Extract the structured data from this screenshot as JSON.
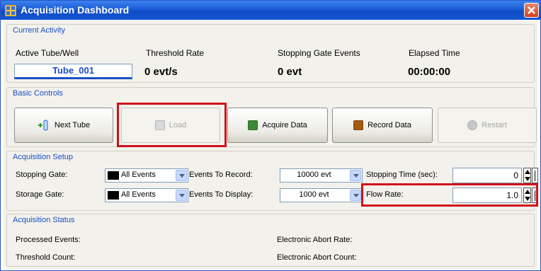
{
  "window": {
    "title": "Acquisition Dashboard"
  },
  "current_activity": {
    "group_title": "Current Activity",
    "labels": {
      "active_tube": "Active Tube/Well",
      "threshold_rate": "Threshold Rate",
      "stopping_gate_events": "Stopping Gate Events",
      "elapsed_time": "Elapsed Time"
    },
    "values": {
      "active_tube": "Tube_001",
      "threshold_rate": "0 evt/s",
      "stopping_gate_events": "0 evt",
      "elapsed_time": "00:00:00"
    }
  },
  "basic_controls": {
    "group_title": "Basic Controls",
    "buttons": {
      "next_tube": "Next Tube",
      "load": "Load",
      "acquire": "Acquire Data",
      "record": "Record Data",
      "restart": "Restart"
    }
  },
  "acquisition_setup": {
    "group_title": "Acquisition Setup",
    "labels": {
      "stopping_gate": "Stopping Gate:",
      "storage_gate": "Storage Gate:",
      "events_to_record": "Events To Record:",
      "events_to_display": "Events To Display:",
      "stopping_time": "Stopping Time (sec):",
      "flow_rate": "Flow Rate:"
    },
    "values": {
      "stopping_gate": "All Events",
      "storage_gate": "All Events",
      "events_to_record": "10000 evt",
      "events_to_display": "1000 evt",
      "stopping_time": "0",
      "flow_rate": "1.0"
    }
  },
  "acquisition_status": {
    "group_title": "Acquisition Status",
    "labels": {
      "processed_events": "Processed Events:",
      "threshold_count": "Threshold Count:",
      "electronic_abort_rate": "Electronic Abort Rate:",
      "electronic_abort_count": "Electronic Abort Count:"
    }
  },
  "colors": {
    "title_bar": "#1a5bd6",
    "group_title": "#1b4fc7",
    "highlight": "#d0121b",
    "acquire_icon": "#3a8a3a",
    "record_icon": "#a45a10"
  },
  "icons": [
    "app-icon",
    "close-icon",
    "next-tube-icon",
    "load-icon",
    "acquire-icon",
    "record-icon",
    "restart-icon",
    "dropdown-arrow-icon",
    "spinner-icon"
  ]
}
